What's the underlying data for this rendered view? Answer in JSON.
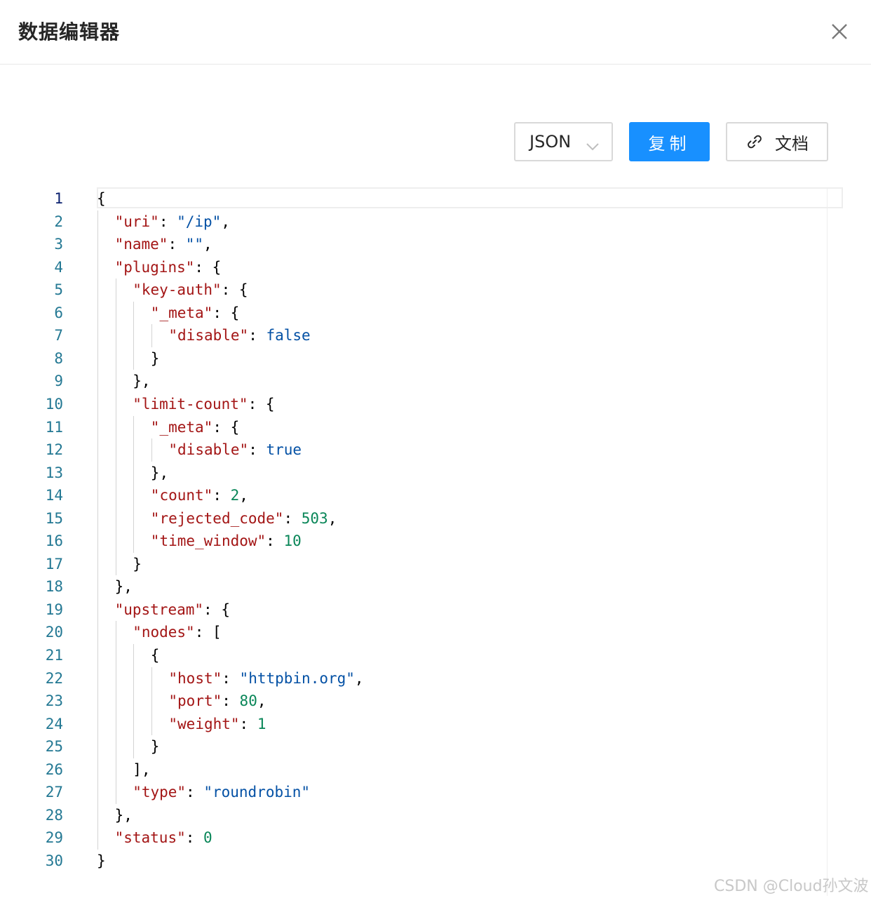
{
  "dialog": {
    "title": "数据编辑器"
  },
  "toolbar": {
    "format_value": "JSON",
    "copy_label": "复制",
    "docs_label": "文档"
  },
  "icons": {
    "close": "close-icon",
    "chevron": "chevron-down-icon",
    "link": "link-icon"
  },
  "colors": {
    "primary": "#1890ff",
    "key": "#a31515",
    "string": "#0451a5",
    "number": "#098658",
    "line_number": "#237893"
  },
  "editor": {
    "active_line": 1,
    "lines": [
      {
        "n": "1",
        "indent": 0,
        "tokens": [
          [
            "p",
            "{"
          ]
        ]
      },
      {
        "n": "2",
        "indent": 1,
        "tokens": [
          [
            "k",
            "\"uri\""
          ],
          [
            "p",
            ": "
          ],
          [
            "s",
            "\"/ip\""
          ],
          [
            "p",
            ","
          ]
        ]
      },
      {
        "n": "3",
        "indent": 1,
        "tokens": [
          [
            "k",
            "\"name\""
          ],
          [
            "p",
            ": "
          ],
          [
            "s",
            "\"\""
          ],
          [
            "p",
            ","
          ]
        ]
      },
      {
        "n": "4",
        "indent": 1,
        "tokens": [
          [
            "k",
            "\"plugins\""
          ],
          [
            "p",
            ": {"
          ]
        ]
      },
      {
        "n": "5",
        "indent": 2,
        "tokens": [
          [
            "k",
            "\"key-auth\""
          ],
          [
            "p",
            ": {"
          ]
        ]
      },
      {
        "n": "6",
        "indent": 3,
        "tokens": [
          [
            "k",
            "\"_meta\""
          ],
          [
            "p",
            ": {"
          ]
        ]
      },
      {
        "n": "7",
        "indent": 4,
        "tokens": [
          [
            "k",
            "\"disable\""
          ],
          [
            "p",
            ": "
          ],
          [
            "b",
            "false"
          ]
        ]
      },
      {
        "n": "8",
        "indent": 3,
        "tokens": [
          [
            "p",
            "}"
          ]
        ]
      },
      {
        "n": "9",
        "indent": 2,
        "tokens": [
          [
            "p",
            "},"
          ]
        ]
      },
      {
        "n": "10",
        "indent": 2,
        "tokens": [
          [
            "k",
            "\"limit-count\""
          ],
          [
            "p",
            ": {"
          ]
        ]
      },
      {
        "n": "11",
        "indent": 3,
        "tokens": [
          [
            "k",
            "\"_meta\""
          ],
          [
            "p",
            ": {"
          ]
        ]
      },
      {
        "n": "12",
        "indent": 4,
        "tokens": [
          [
            "k",
            "\"disable\""
          ],
          [
            "p",
            ": "
          ],
          [
            "b",
            "true"
          ]
        ]
      },
      {
        "n": "13",
        "indent": 3,
        "tokens": [
          [
            "p",
            "},"
          ]
        ]
      },
      {
        "n": "14",
        "indent": 3,
        "tokens": [
          [
            "k",
            "\"count\""
          ],
          [
            "p",
            ": "
          ],
          [
            "n",
            "2"
          ],
          [
            "p",
            ","
          ]
        ]
      },
      {
        "n": "15",
        "indent": 3,
        "tokens": [
          [
            "k",
            "\"rejected_code\""
          ],
          [
            "p",
            ": "
          ],
          [
            "n",
            "503"
          ],
          [
            "p",
            ","
          ]
        ]
      },
      {
        "n": "16",
        "indent": 3,
        "tokens": [
          [
            "k",
            "\"time_window\""
          ],
          [
            "p",
            ": "
          ],
          [
            "n",
            "10"
          ]
        ]
      },
      {
        "n": "17",
        "indent": 2,
        "tokens": [
          [
            "p",
            "}"
          ]
        ]
      },
      {
        "n": "18",
        "indent": 1,
        "tokens": [
          [
            "p",
            "},"
          ]
        ]
      },
      {
        "n": "19",
        "indent": 1,
        "tokens": [
          [
            "k",
            "\"upstream\""
          ],
          [
            "p",
            ": {"
          ]
        ]
      },
      {
        "n": "20",
        "indent": 2,
        "tokens": [
          [
            "k",
            "\"nodes\""
          ],
          [
            "p",
            ": ["
          ]
        ]
      },
      {
        "n": "21",
        "indent": 3,
        "tokens": [
          [
            "p",
            "{"
          ]
        ]
      },
      {
        "n": "22",
        "indent": 4,
        "tokens": [
          [
            "k",
            "\"host\""
          ],
          [
            "p",
            ": "
          ],
          [
            "s",
            "\"httpbin.org\""
          ],
          [
            "p",
            ","
          ]
        ]
      },
      {
        "n": "23",
        "indent": 4,
        "tokens": [
          [
            "k",
            "\"port\""
          ],
          [
            "p",
            ": "
          ],
          [
            "n",
            "80"
          ],
          [
            "p",
            ","
          ]
        ]
      },
      {
        "n": "24",
        "indent": 4,
        "tokens": [
          [
            "k",
            "\"weight\""
          ],
          [
            "p",
            ": "
          ],
          [
            "n",
            "1"
          ]
        ]
      },
      {
        "n": "25",
        "indent": 3,
        "tokens": [
          [
            "p",
            "}"
          ]
        ]
      },
      {
        "n": "26",
        "indent": 2,
        "tokens": [
          [
            "p",
            "],"
          ]
        ]
      },
      {
        "n": "27",
        "indent": 2,
        "tokens": [
          [
            "k",
            "\"type\""
          ],
          [
            "p",
            ": "
          ],
          [
            "s",
            "\"roundrobin\""
          ]
        ]
      },
      {
        "n": "28",
        "indent": 1,
        "tokens": [
          [
            "p",
            "},"
          ]
        ]
      },
      {
        "n": "29",
        "indent": 1,
        "tokens": [
          [
            "k",
            "\"status\""
          ],
          [
            "p",
            ": "
          ],
          [
            "n",
            "0"
          ]
        ]
      },
      {
        "n": "30",
        "indent": 0,
        "tokens": [
          [
            "p",
            "}"
          ]
        ]
      }
    ]
  },
  "watermark": "CSDN @Cloud孙文波"
}
